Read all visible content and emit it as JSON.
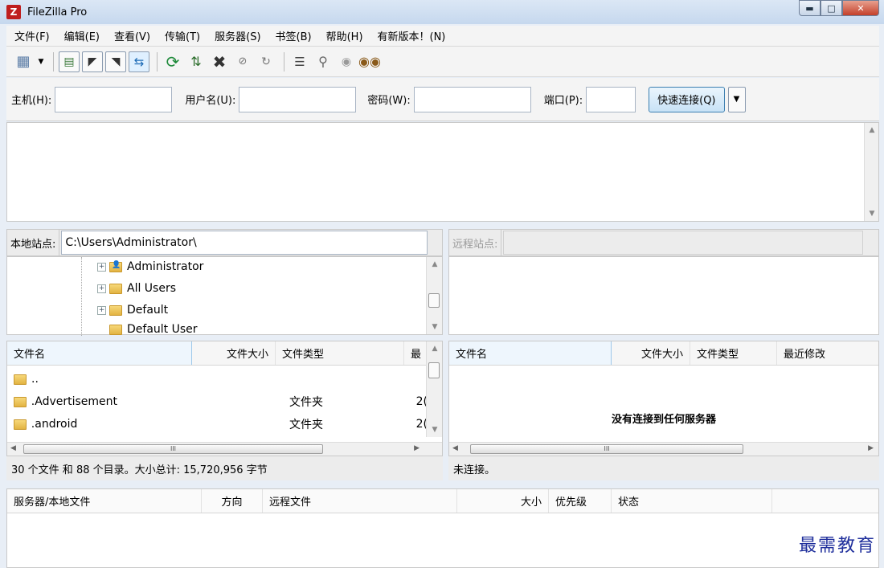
{
  "window": {
    "title": "FileZilla Pro",
    "icon_letter": "Z"
  },
  "menu": [
    "文件(F)",
    "编辑(E)",
    "查看(V)",
    "传输(T)",
    "服务器(S)",
    "书签(B)",
    "帮助(H)",
    "有新版本！(N)"
  ],
  "quickconnect": {
    "host_label": "主机(H):",
    "host_value": "",
    "user_label": "用户名(U):",
    "user_value": "",
    "pass_label": "密码(W):",
    "pass_value": "",
    "port_label": "端口(P):",
    "port_value": "",
    "connect_label": "快速连接(Q)"
  },
  "local": {
    "site_label": "本地站点:",
    "path": "C:\\Users\\Administrator\\",
    "tree": [
      "Administrator",
      "All Users",
      "Default",
      "Default User"
    ],
    "columns": [
      "文件名",
      "文件大小",
      "文件类型",
      "最"
    ],
    "files": [
      {
        "name": "..",
        "size": "",
        "type": "",
        "modified": ""
      },
      {
        "name": ".Advertisement",
        "size": "",
        "type": "文件夹",
        "modified": "2("
      },
      {
        "name": ".android",
        "size": "",
        "type": "文件夹",
        "modified": "2("
      }
    ],
    "status": "30 个文件 和 88 个目录。大小总计: 15,720,956 字节"
  },
  "remote": {
    "site_label": "远程站点:",
    "path": "",
    "columns": [
      "文件名",
      "文件大小",
      "文件类型",
      "最近修改"
    ],
    "empty_message": "没有连接到任何服务器",
    "status": "未连接。"
  },
  "queue": {
    "columns": [
      "服务器/本地文件",
      "方向",
      "远程文件",
      "大小",
      "优先级",
      "状态"
    ]
  },
  "watermark": "最需教育"
}
